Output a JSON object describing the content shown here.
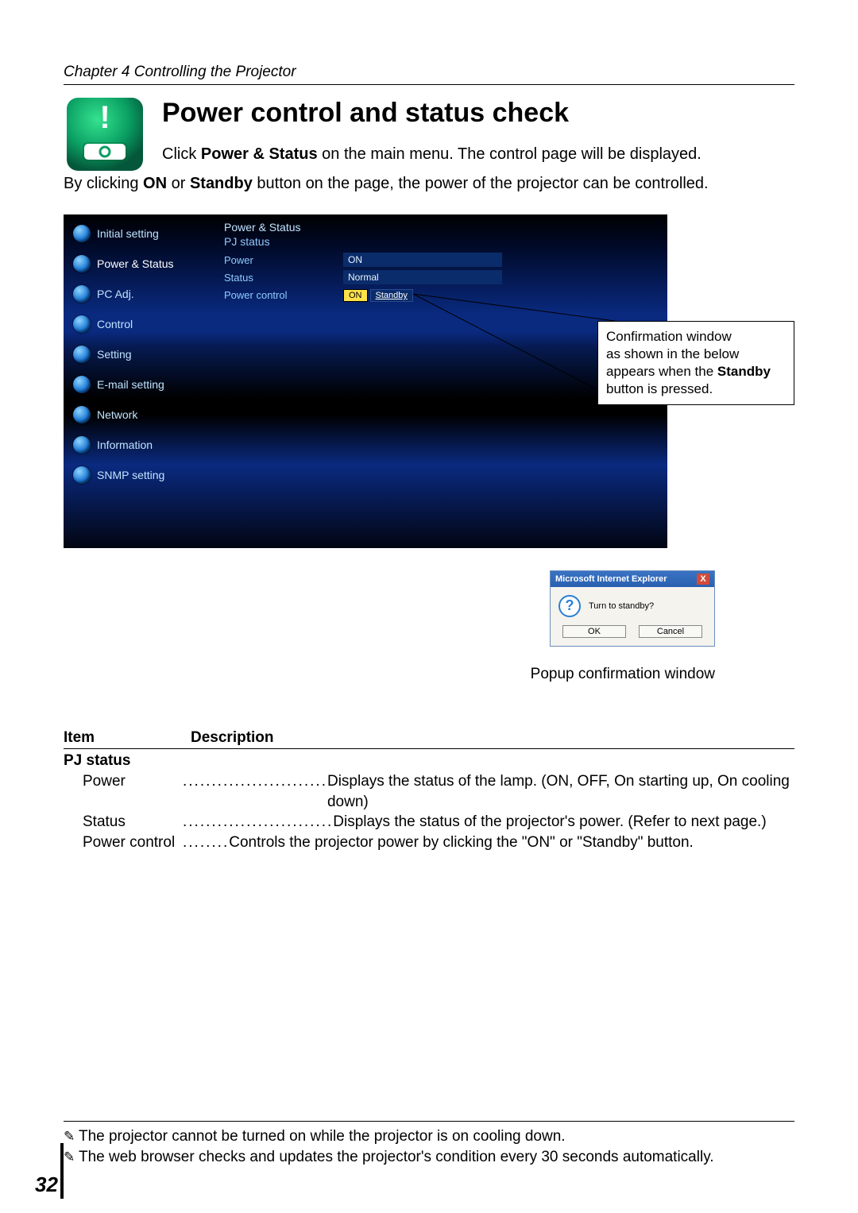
{
  "chapter": "Chapter 4 Controlling the Projector",
  "title": "Power control and status check",
  "intro_prefix": "Click ",
  "intro_bold1": "Power & Status",
  "intro_suffix": " on the main menu. The control page will be displayed.",
  "intro2_prefix": "By clicking ",
  "intro2_bold1": "ON",
  "intro2_mid": " or ",
  "intro2_bold2": "Standby",
  "intro2_suffix": " button on the page, the power of the projector can be controlled.",
  "shot": {
    "sidebar": [
      "Initial setting",
      "Power & Status",
      "PC Adj.",
      "Control",
      "Setting",
      "E-mail setting",
      "Network",
      "Information",
      "SNMP setting"
    ],
    "panel_title": "Power & Status",
    "panel_sub": "PJ status",
    "rows": {
      "power_label": "Power",
      "power_value": "ON",
      "status_label": "Status",
      "status_value": "Normal",
      "power_control_label": "Power control",
      "on_btn": "ON",
      "standby_btn": "Standby"
    }
  },
  "callout_line1": "Confirmation window",
  "callout_line2": "as shown in the below",
  "callout_line3_prefix": "appears  when the ",
  "callout_line3_bold": "Standby",
  "callout_line4": "button is pressed.",
  "popup": {
    "title": "Microsoft Internet Explorer",
    "message": "Turn to standby?",
    "ok": "OK",
    "cancel": "Cancel"
  },
  "popup_caption": "Popup confirmation window",
  "table": {
    "col1": "Item",
    "col2": "Description",
    "group": "PJ status",
    "rows": [
      {
        "term": "Power",
        "dots": ".........................",
        "desc": "Displays the status of the lamp. (ON, OFF, On starting up, On cooling down)"
      },
      {
        "term": "Status",
        "dots": "..........................",
        "desc": "Displays the status of the projector's power. (Refer to next page.)"
      },
      {
        "term": "Power control",
        "dots": "........",
        "desc": "Controls the projector power by clicking the \"ON\" or \"Standby\" button."
      }
    ]
  },
  "notes": [
    "The projector cannot be turned on while the projector is on cooling down.",
    "The web browser checks and updates the projector's condition every 30 seconds automatically."
  ],
  "page_number": "32"
}
